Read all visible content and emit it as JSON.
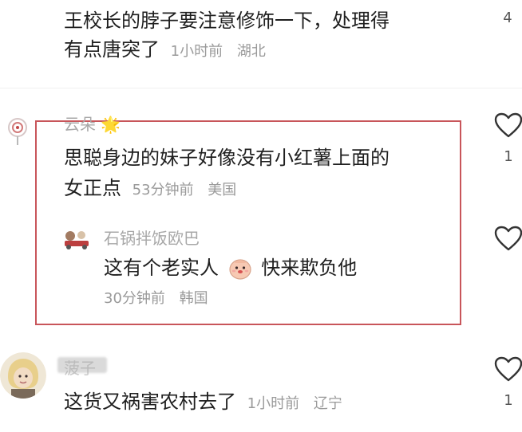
{
  "comments": [
    {
      "text_line1": "王校长的脖子要注意修饰一下，处理得",
      "text_line2": "有点唐突了",
      "time": "1小时前",
      "location": "湖北",
      "like_count": "4"
    },
    {
      "username": "云朵",
      "username_emoji": "🌟",
      "text_line1": "思聪身边的妹子好像没有小红薯上面的",
      "text_line2": "女正点",
      "time": "53分钟前",
      "location": "美国",
      "like_count": "1",
      "reply": {
        "username": "石锅拌饭欧巴",
        "text_before": "这有个老实人",
        "text_after": "快来欺负他",
        "time": "30分钟前",
        "location": "韩国"
      }
    },
    {
      "username": "菠子",
      "text": "这货又祸害农村去了",
      "time": "1小时前",
      "location": "辽宁",
      "like_count": "1"
    }
  ],
  "colors": {
    "highlight_border": "#c8555a",
    "meta_text": "#9a9a9a",
    "main_text": "#1f1f1f"
  },
  "icons": {
    "like": "heart-outline-icon",
    "emoji": "face-emoji-icon"
  }
}
